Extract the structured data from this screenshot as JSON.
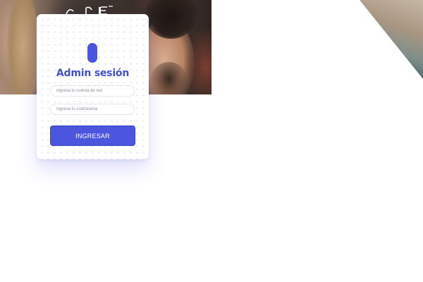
{
  "login": {
    "title": "Admin sesión",
    "username_placeholder": "Ingresa tu cuenta de red",
    "password_placeholder": "Ingresa tu contraseña",
    "submit_label": "INGRESAR"
  },
  "colors": {
    "accent": "#4b55de",
    "title": "#4350d4",
    "background": "#ffffff"
  },
  "icons": {
    "brand": "rounded-pill-logo-icon"
  }
}
